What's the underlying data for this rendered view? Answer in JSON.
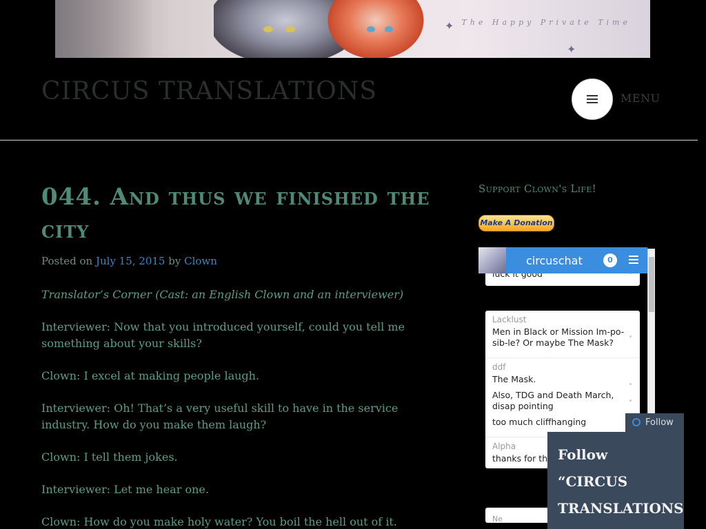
{
  "banner": {
    "tagline": "The Happy Private Time"
  },
  "site": {
    "title": "CIRCUS TRANSLATIONS",
    "menu_label": "MENU"
  },
  "post": {
    "title": "044. And thus we finished the city",
    "meta_prefix": "Posted on",
    "date": "July 15, 2015",
    "by": "by",
    "author": "Clown",
    "paragraphs": [
      "Translator’s Corner (Cast: an English Clown and an interviewer)",
      "Interviewer: Now that you introduced yourself, could you tell me something about your skills?",
      "Clown: I excel at making people laugh.",
      "Interviewer: Oh! That’s a very useful skill to have in the service industry. How do you make them laugh?",
      "Clown: I tell them jokes.",
      "Interviewer: Let me hear one.",
      "Clown: How do you make holy water? You boil the hell out of it."
    ]
  },
  "sidebar": {
    "support_title": "Support Clown's Life!",
    "donate_label": "Make A Donation"
  },
  "chat": {
    "name": "circuschat",
    "count": "0",
    "top_partial": "luck it good",
    "messages": [
      {
        "user": "Lacklust",
        "lines": [
          "Men in Black or Mission Im-po-sib-le? Or maybe The Mask?"
        ]
      },
      {
        "user": "ddf",
        "lines": [
          "The Mask.",
          "Also, TDG and Death March, disap pointing",
          "too much cliffhanging"
        ]
      },
      {
        "user": "Alpha",
        "lines": [
          "thanks for the"
        ]
      }
    ],
    "bottom_partial": "Ne"
  },
  "follow": {
    "tab_label": "Follow",
    "panel_text": "Follow “CIRCUS TRANSLATIONS ”"
  },
  "colors": {
    "accent": "#4f8a79",
    "link": "#3c83c8",
    "chat_header": "#3b8de0",
    "follow_bg": "#3a4a5c"
  }
}
